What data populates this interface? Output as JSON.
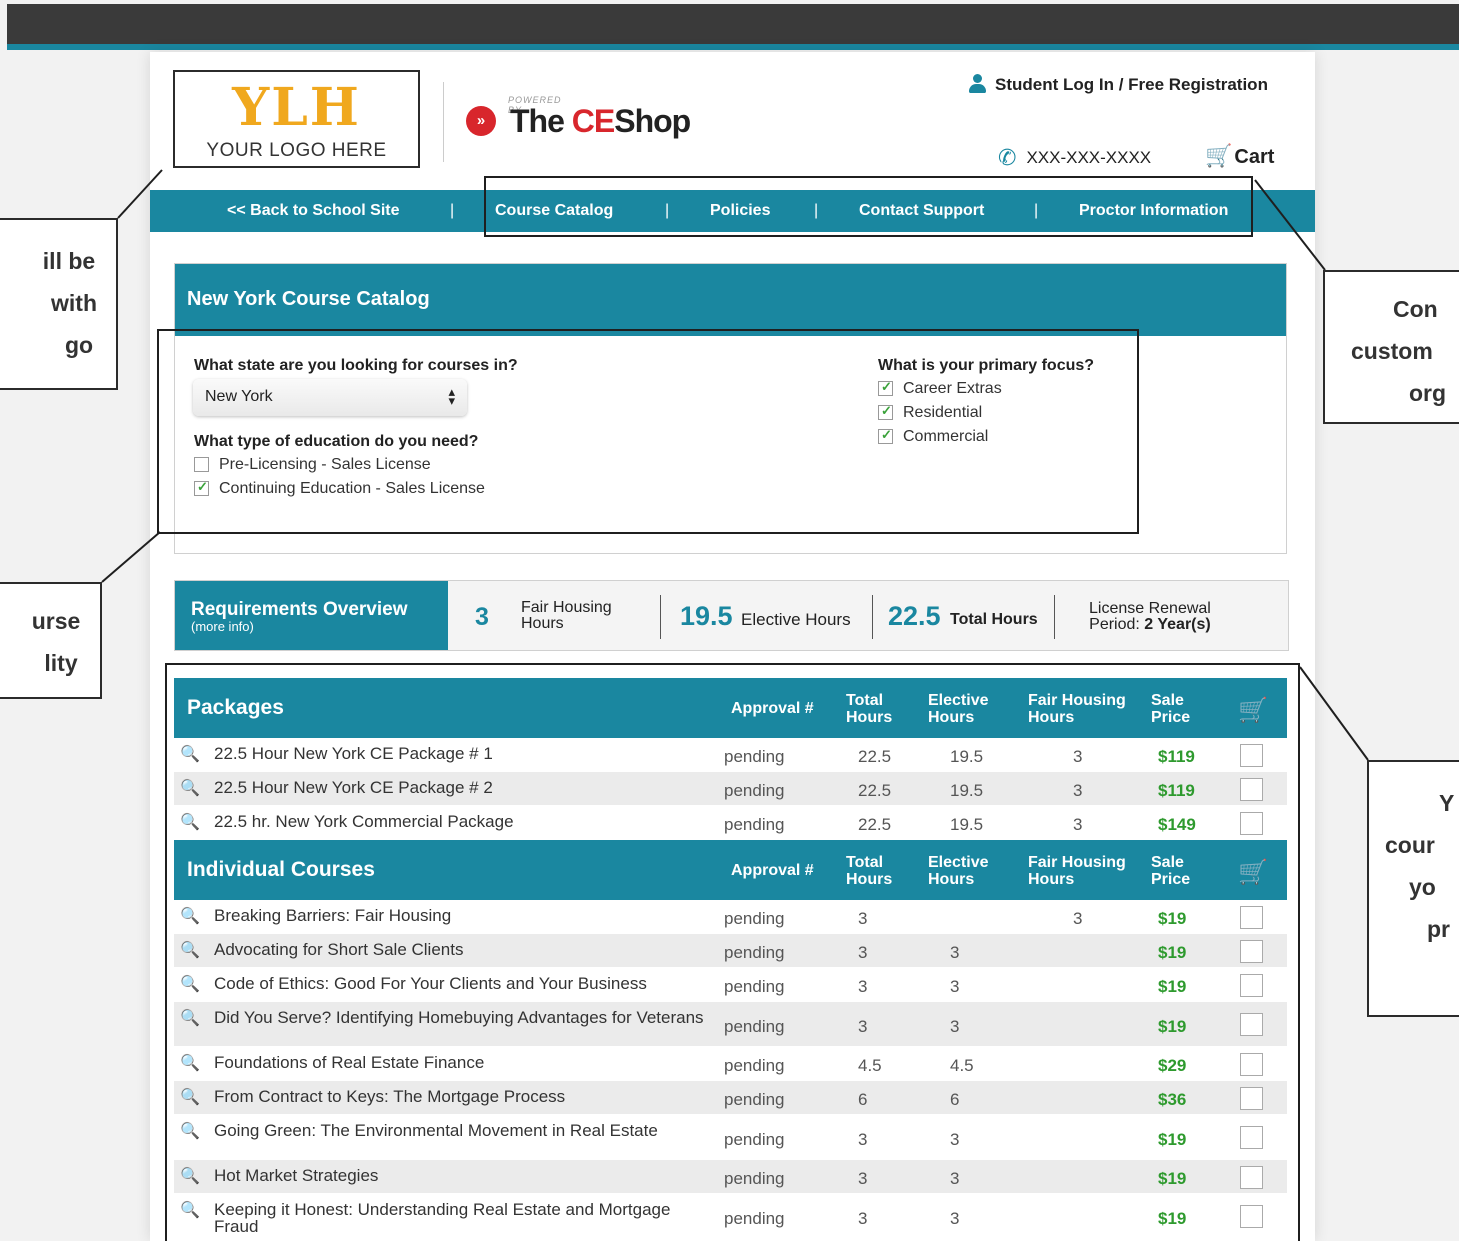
{
  "header": {
    "logo_mark": "YLH",
    "logo_text": "YOUR LOGO HERE",
    "powered_by": "POWERED BY",
    "brand_the": "The",
    "brand_ce": "CE",
    "brand_shop": "Shop",
    "login_label": "Student Log In / Free Registration",
    "phone": "XXX-XXX-XXXX",
    "cart_label": "Cart"
  },
  "nav": {
    "back": "<< Back to School Site",
    "catalog": "Course Catalog",
    "policies": "Policies",
    "support": "Contact Support",
    "proctor": "Proctor Information",
    "separator": "|"
  },
  "catalog": {
    "title": "New York Course Catalog",
    "state_question": "What state are you looking for courses in?",
    "state_value": "New York",
    "education_question": "What type of education do you need?",
    "education_options": [
      {
        "label": "Pre-Licensing - Sales License",
        "checked": false
      },
      {
        "label": "Continuing Education - Sales License",
        "checked": true
      }
    ],
    "focus_question": "What is your primary focus?",
    "focus_options": [
      {
        "label": "Career Extras",
        "checked": true
      },
      {
        "label": "Residential",
        "checked": true
      },
      {
        "label": "Commercial",
        "checked": true
      }
    ]
  },
  "requirements": {
    "title": "Requirements Overview",
    "subtitle": "(more info)",
    "fair_housing_value": "3",
    "fair_housing_label_1": "Fair Housing",
    "fair_housing_label_2": "Hours",
    "elective_value": "19.5",
    "elective_label": "Elective Hours",
    "total_value": "22.5",
    "total_label": "Total Hours",
    "renewal_label": "License Renewal",
    "renewal_period_prefix": "Period:",
    "renewal_period_value": "2 Year(s)"
  },
  "columns": {
    "approval": "Approval #",
    "total_1": "Total",
    "total_2": "Hours",
    "elective_1": "Elective",
    "elective_2": "Hours",
    "fair_1": "Fair Housing",
    "fair_2": "Hours",
    "sale_1": "Sale",
    "sale_2": "Price"
  },
  "packages": {
    "title": "Packages",
    "rows": [
      {
        "name": "22.5 Hour New York CE Package # 1",
        "approval": "pending",
        "total": "22.5",
        "elective": "19.5",
        "fair": "3",
        "price": "$119"
      },
      {
        "name": "22.5 Hour New York CE Package # 2",
        "approval": "pending",
        "total": "22.5",
        "elective": "19.5",
        "fair": "3",
        "price": "$119"
      },
      {
        "name": "22.5 hr. New York Commercial Package",
        "approval": "pending",
        "total": "22.5",
        "elective": "19.5",
        "fair": "3",
        "price": "$149"
      }
    ]
  },
  "courses": {
    "title": "Individual Courses",
    "rows": [
      {
        "name": "Breaking Barriers: Fair Housing",
        "approval": "pending",
        "total": "3",
        "elective": "",
        "fair": "3",
        "price": "$19"
      },
      {
        "name": "Advocating for Short Sale Clients",
        "approval": "pending",
        "total": "3",
        "elective": "3",
        "fair": "",
        "price": "$19"
      },
      {
        "name": "Code of Ethics: Good For Your Clients and Your Business",
        "approval": "pending",
        "total": "3",
        "elective": "3",
        "fair": "",
        "price": "$19"
      },
      {
        "name": "Did You Serve? Identifying Homebuying Advantages for Veterans",
        "approval": "pending",
        "total": "3",
        "elective": "3",
        "fair": "",
        "price": "$19"
      },
      {
        "name": "Foundations of Real Estate Finance",
        "approval": "pending",
        "total": "4.5",
        "elective": "4.5",
        "fair": "",
        "price": "$29"
      },
      {
        "name": "From Contract to Keys: The Mortgage Process",
        "approval": "pending",
        "total": "6",
        "elective": "6",
        "fair": "",
        "price": "$36"
      },
      {
        "name": "Going Green: The Environmental Movement in Real Estate",
        "approval": "pending",
        "total": "3",
        "elective": "3",
        "fair": "",
        "price": "$19"
      },
      {
        "name": "Hot Market Strategies",
        "approval": "pending",
        "total": "3",
        "elective": "3",
        "fair": "",
        "price": "$19"
      },
      {
        "name": "Keeping it Honest: Understanding Real Estate and Mortgage Fraud",
        "approval": "pending",
        "total": "3",
        "elective": "3",
        "fair": "",
        "price": "$19"
      }
    ]
  },
  "annotations": {
    "left_1": [
      "ill be",
      "with",
      "go"
    ],
    "left_2": [
      "urse",
      "lity"
    ],
    "right_1": [
      "Con",
      "custom",
      "org"
    ],
    "right_2": [
      "Y",
      "cour",
      "yo",
      "pr"
    ]
  },
  "colors": {
    "accent": "#1a87a0",
    "price": "#2e9a2e",
    "logo": "#f0a81e",
    "brand_red": "#d8262c"
  }
}
